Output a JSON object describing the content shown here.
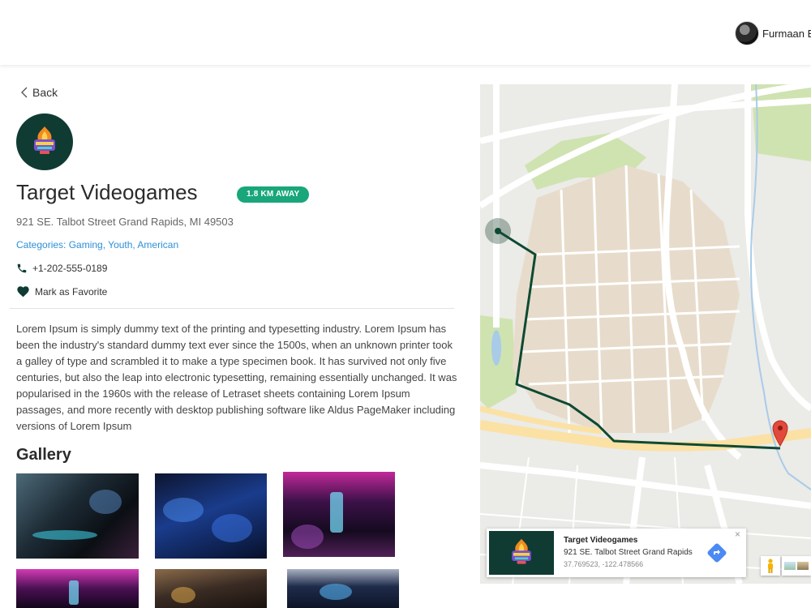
{
  "header": {
    "user_name": "Furmaan B"
  },
  "nav": {
    "back_label": "Back"
  },
  "business": {
    "name": "Target Videogames",
    "distance_badge": "1.8 KM AWAY",
    "address": "921 SE. Talbot Street Grand Rapids, MI 49503",
    "categories": "Categories: Gaming, Youth, American",
    "phone": "+1-202-555-0189",
    "favorite_label": "Mark as Favorite",
    "logo_icon": "game-over-logo",
    "description": "Lorem Ipsum is simply dummy text of the printing and typesetting industry. Lorem Ipsum has been the industry's standard dummy text ever since the 1500s, when an unknown printer took a galley of type and scrambled it to make a type specimen book. It has survived not only five centuries, but also the leap into electronic typesetting, remaining essentially unchanged. It was popularised in the 1960s with the release of Letraset sheets containing Lorem Ipsum passages, and more recently with desktop publishing software like Aldus PageMaker including versions of Lorem Ipsum"
  },
  "gallery": {
    "title": "Gallery",
    "images": [
      "gaming-setup-photo",
      "arcade-room-photo",
      "neon-gaming-lounge-photo",
      "pc-rigs-photo",
      "arcade-hall-photo",
      "game-cabinets-photo"
    ]
  },
  "map": {
    "info": {
      "title": "Target Videogames",
      "address": "921 SE. Talbot Street Grand Rapids",
      "coords": "37.769523, -122.478566",
      "close": "×"
    }
  },
  "colors": {
    "accent_green": "#18a67a",
    "dark_green": "#0f3b33",
    "link_blue": "#2d8fd8",
    "route": "#0d4a33"
  }
}
